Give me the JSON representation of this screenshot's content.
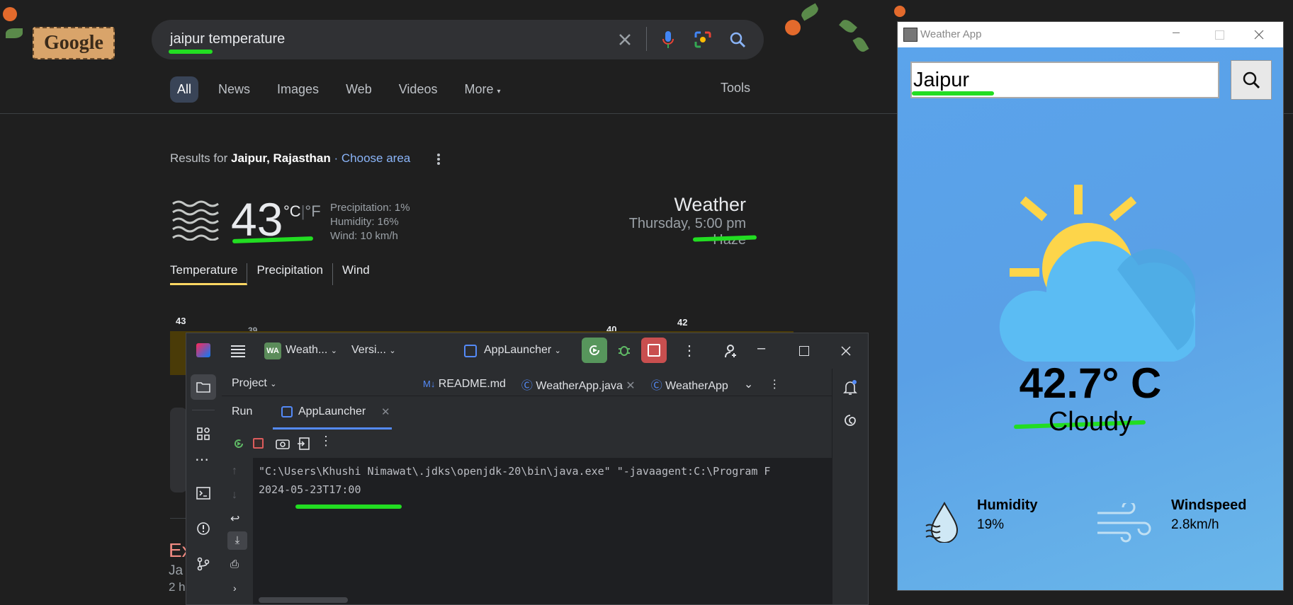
{
  "google": {
    "logo_text": "Google",
    "query": "jaipur temperature",
    "tabs": [
      "All",
      "News",
      "Images",
      "Web",
      "Videos",
      "More"
    ],
    "tools_label": "Tools",
    "results_prefix": "Results for",
    "location": "Jaipur, Rajasthan",
    "choose_area": "· Choose area",
    "weather": {
      "temperature": "43",
      "unit_c": "°C",
      "unit_f": "°F",
      "precipitation": "Precipitation: 1%",
      "humidity": "Humidity: 16%",
      "wind": "Wind: 10 km/h",
      "title": "Weather",
      "date_prefix": "Thursday,",
      "time": "5:00 pm",
      "condition": "Haze",
      "tabs": [
        "Temperature",
        "Precipitation",
        "Wind"
      ],
      "chart_labels": [
        "43",
        "39",
        "40",
        "42"
      ]
    },
    "partial_result": {
      "title": "Ex",
      "line1": "Ja",
      "line2": "2 h"
    }
  },
  "ide": {
    "project_badge": "WA",
    "project_name": "Weath...",
    "version_menu": "Versi...",
    "run_config": "AppLauncher",
    "project_panel": "Project",
    "editor_tabs": [
      "README.md",
      "WeatherApp.java",
      "WeatherApp"
    ],
    "run_label": "Run",
    "run_tab": "AppLauncher",
    "console_lines": [
      "\"C:\\Users\\Khushi Nimawat\\.jdks\\openjdk-20\\bin\\java.exe\" \"-javaagent:C:\\Program F",
      "2024-05-23T17:00"
    ]
  },
  "weather_app": {
    "window_title": "Weather App",
    "city_input": "Jaipur",
    "temperature": "42.7° C",
    "condition": "Cloudy",
    "humidity_label": "Humidity",
    "humidity_value": "19%",
    "windspeed_label": "Windspeed",
    "windspeed_value": "2.8km/h"
  },
  "colors": {
    "google_bg": "#1f1f1f",
    "link": "#8ab4f8",
    "highlight_annotation": "#22dd22",
    "app_sky": "#5aa0e6",
    "sun": "#fdd54a",
    "cloud": "#5bbcf3"
  }
}
